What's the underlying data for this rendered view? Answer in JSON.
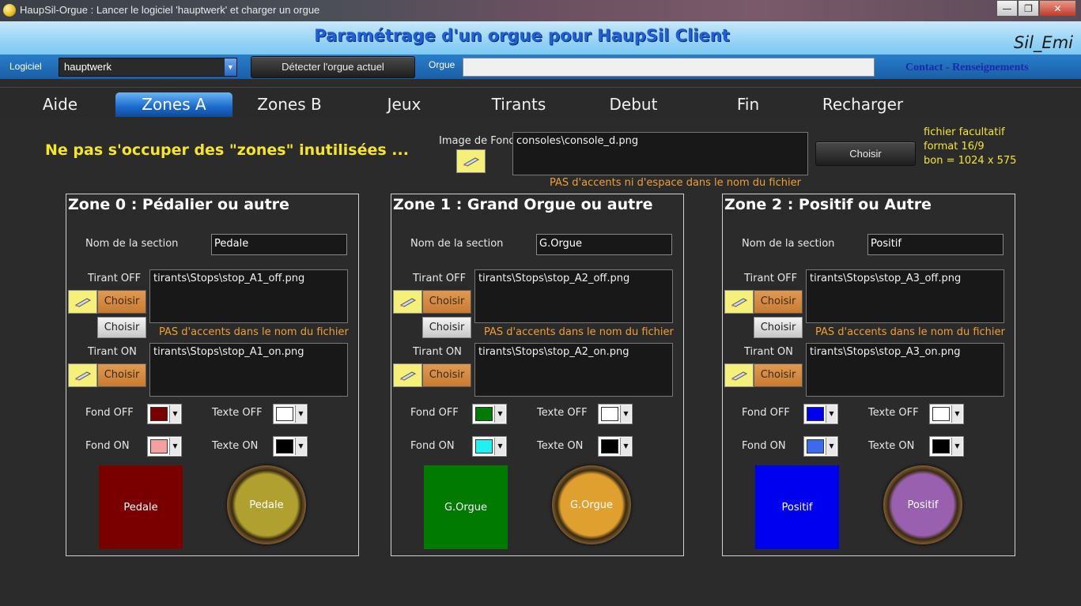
{
  "window": {
    "title": "HaupSil-Orgue  :  Lancer le logiciel 'hauptwerk' et charger un orgue",
    "minimize": "—",
    "maximize": "❐",
    "close": "✕"
  },
  "header": {
    "title": "Paramétrage d'un orgue pour HaupSil Client",
    "brand": "Sil_Emi",
    "logiciel_label": "Logiciel",
    "logiciel_value": "hauptwerk",
    "detect_button": "Détecter l'orgue actuel",
    "orgue_label": "Orgue",
    "orgue_value": "",
    "contact": "Contact - Renseignements"
  },
  "tabs": [
    {
      "label": "Aide"
    },
    {
      "label": "Zones A"
    },
    {
      "label": "Zones B"
    },
    {
      "label": "Jeux"
    },
    {
      "label": "Tirants"
    },
    {
      "label": "Debut"
    },
    {
      "label": "Fin"
    },
    {
      "label": "Recharger"
    }
  ],
  "background": {
    "warning": "Ne pas s'occuper des \"zones\" inutilisées ...",
    "label": "Image de Fond",
    "value": "consoles\\console_d.png",
    "choose_button": "Choisir",
    "note_accents": "PAS d'accents ni d'espace dans le nom du fichier",
    "hint_line1": "fichier facultatif",
    "hint_line2": "format 16/9",
    "hint_line3": "bon = 1024 x 575"
  },
  "common": {
    "section_label": "Nom de la section",
    "tirant_off_label": "Tirant OFF",
    "tirant_on_label": "Tirant ON",
    "choose": "Choisir",
    "note_accents": "PAS d'accents dans le nom du fichier",
    "fond_off": "Fond OFF",
    "texte_off": "Texte OFF",
    "fond_on": "Fond ON",
    "texte_on": "Texte ON"
  },
  "zones": [
    {
      "title": "Zone 0 : Pédalier ou autre",
      "section_name": "Pedale",
      "tirant_off": "tirants\\Stops\\stop_A1_off.png",
      "tirant_on": "tirants\\Stops\\stop_A1_on.png",
      "fond_off_color": "#7a0000",
      "texte_off_color": "#ffffff",
      "fond_on_color": "#f4a0a0",
      "texte_on_color": "#000000",
      "preview_label": "Pedale",
      "knob_color": "#b0a030"
    },
    {
      "title": "Zone 1 : Grand Orgue ou autre",
      "section_name": "G.Orgue",
      "tirant_off": "tirants\\Stops\\stop_A2_off.png",
      "tirant_on": "tirants\\Stops\\stop_A2_on.png",
      "fond_off_color": "#007a00",
      "texte_off_color": "#ffffff",
      "fond_on_color": "#20f0f0",
      "texte_on_color": "#000000",
      "preview_label": "G.Orgue",
      "knob_color": "#e0a030"
    },
    {
      "title": "Zone 2 : Positif ou Autre",
      "section_name": "Positif",
      "tirant_off": "tirants\\Stops\\stop_A3_off.png",
      "tirant_on": "tirants\\Stops\\stop_A3_on.png",
      "fond_off_color": "#0000f0",
      "texte_off_color": "#ffffff",
      "fond_on_color": "#3a6af0",
      "texte_on_color": "#000000",
      "preview_label": "Positif",
      "knob_color": "#9a60b0"
    }
  ]
}
